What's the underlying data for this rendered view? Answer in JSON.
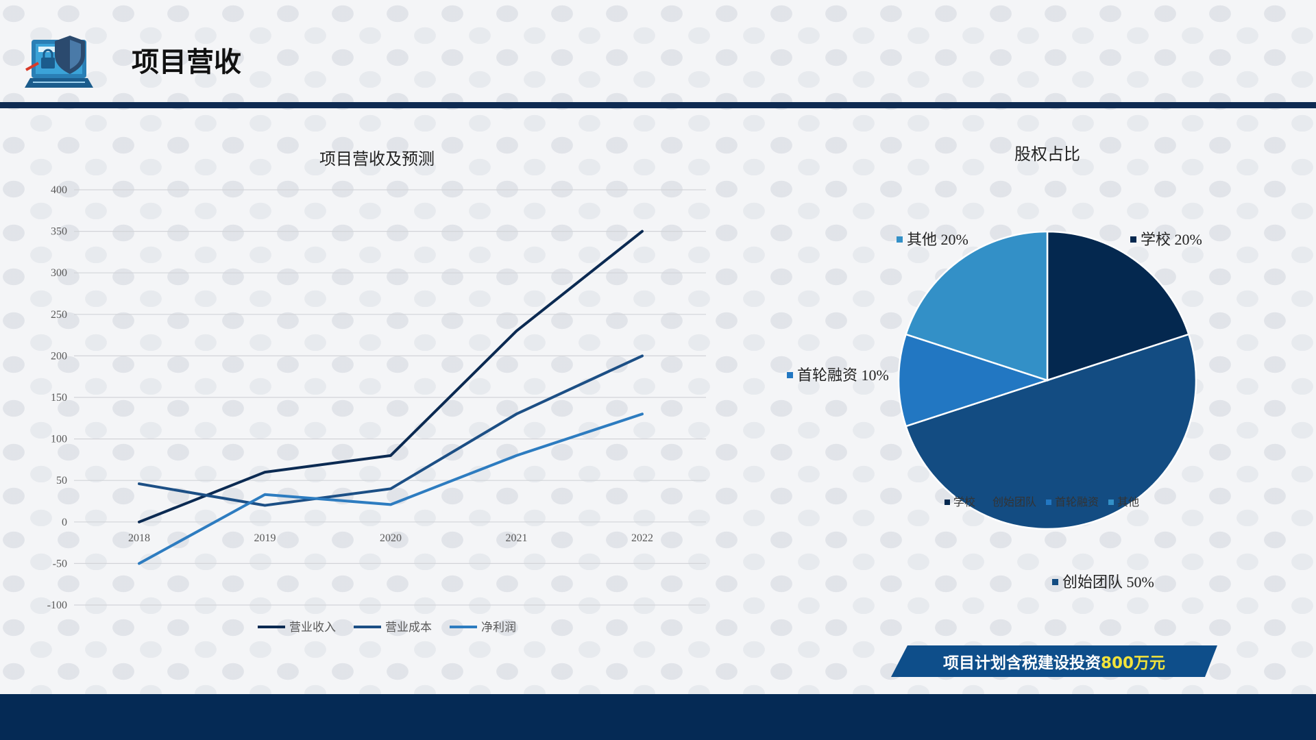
{
  "page": {
    "title": "项目营收"
  },
  "banner": {
    "prefix": "项目计划含税建设投资",
    "highlight": "800万元"
  },
  "colors": {
    "navy": "#052a55",
    "accent_yellow": "#f2e33b"
  },
  "icons": {
    "logo": "laptop-shield-icon"
  },
  "chart_data": [
    {
      "type": "line",
      "title": "项目营收及预测",
      "x": [
        "2018",
        "2019",
        "2020",
        "2021",
        "2022"
      ],
      "ylim": [
        -100,
        400
      ],
      "yticks": [
        400,
        350,
        300,
        250,
        200,
        150,
        100,
        50,
        0,
        -50,
        -100
      ],
      "grid": true,
      "legend": "bottom",
      "series": [
        {
          "name": "营业收入",
          "color": "#0b2a52",
          "values": [
            0,
            60,
            80,
            230,
            350
          ]
        },
        {
          "name": "营业成本",
          "color": "#1c4f85",
          "values": [
            46,
            20,
            40,
            130,
            200
          ]
        },
        {
          "name": "净利润",
          "color": "#2d7cc0",
          "values": [
            -50,
            33,
            21,
            80,
            130
          ]
        }
      ]
    },
    {
      "type": "pie",
      "title": "股权占比",
      "legend": "bottom",
      "slices": [
        {
          "label": "学校",
          "value": 20,
          "display": "学校 20%",
          "color": "#04284f"
        },
        {
          "label": "创始团队",
          "value": 50,
          "display": "创始团队 50%",
          "color": "#134c82"
        },
        {
          "label": "首轮融资",
          "value": 10,
          "display": "首轮融资 10%",
          "color": "#2277c2"
        },
        {
          "label": "其他",
          "value": 20,
          "display": "其他 20%",
          "color": "#3390c7"
        }
      ]
    }
  ]
}
